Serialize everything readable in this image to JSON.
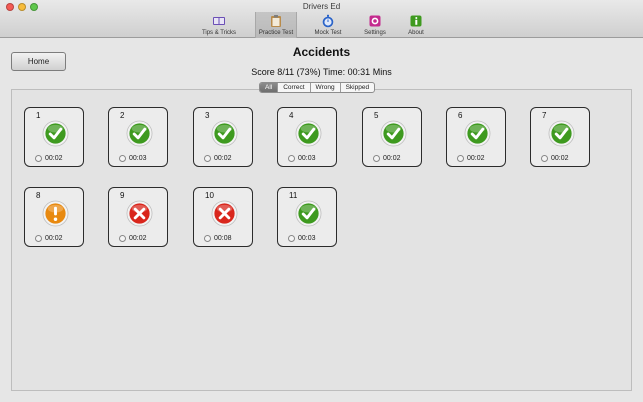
{
  "window": {
    "title": "Drivers Ed"
  },
  "toolbar": {
    "items": [
      {
        "label": "Tips & Tricks",
        "icon": "book-icon",
        "active": false
      },
      {
        "label": "Practice Test",
        "icon": "clipboard-icon",
        "active": true
      },
      {
        "label": "Mock Test",
        "icon": "stopwatch-icon",
        "active": false
      },
      {
        "label": "Settings",
        "icon": "gear-icon",
        "active": false
      },
      {
        "label": "About",
        "icon": "info-icon",
        "active": false
      }
    ]
  },
  "home_label": "Home",
  "page_title": "Accidents",
  "score_text": "Score 8/11 (73%) Time: 00:31 Mins",
  "filters": {
    "all": "All",
    "correct": "Correct",
    "wrong": "Wrong",
    "skipped": "Skipped",
    "selected": "All"
  },
  "results": [
    {
      "num": "1",
      "status": "correct",
      "time": "00:02"
    },
    {
      "num": "2",
      "status": "correct",
      "time": "00:03"
    },
    {
      "num": "3",
      "status": "correct",
      "time": "00:02"
    },
    {
      "num": "4",
      "status": "correct",
      "time": "00:03"
    },
    {
      "num": "5",
      "status": "correct",
      "time": "00:02"
    },
    {
      "num": "6",
      "status": "correct",
      "time": "00:02"
    },
    {
      "num": "7",
      "status": "correct",
      "time": "00:02"
    },
    {
      "num": "8",
      "status": "skipped",
      "time": "00:02"
    },
    {
      "num": "9",
      "status": "wrong",
      "time": "00:02"
    },
    {
      "num": "10",
      "status": "wrong",
      "time": "00:08"
    },
    {
      "num": "11",
      "status": "correct",
      "time": "00:03"
    }
  ],
  "colors": {
    "correct": "#3e9a1f",
    "wrong": "#d9261c",
    "skipped": "#e8890f"
  }
}
